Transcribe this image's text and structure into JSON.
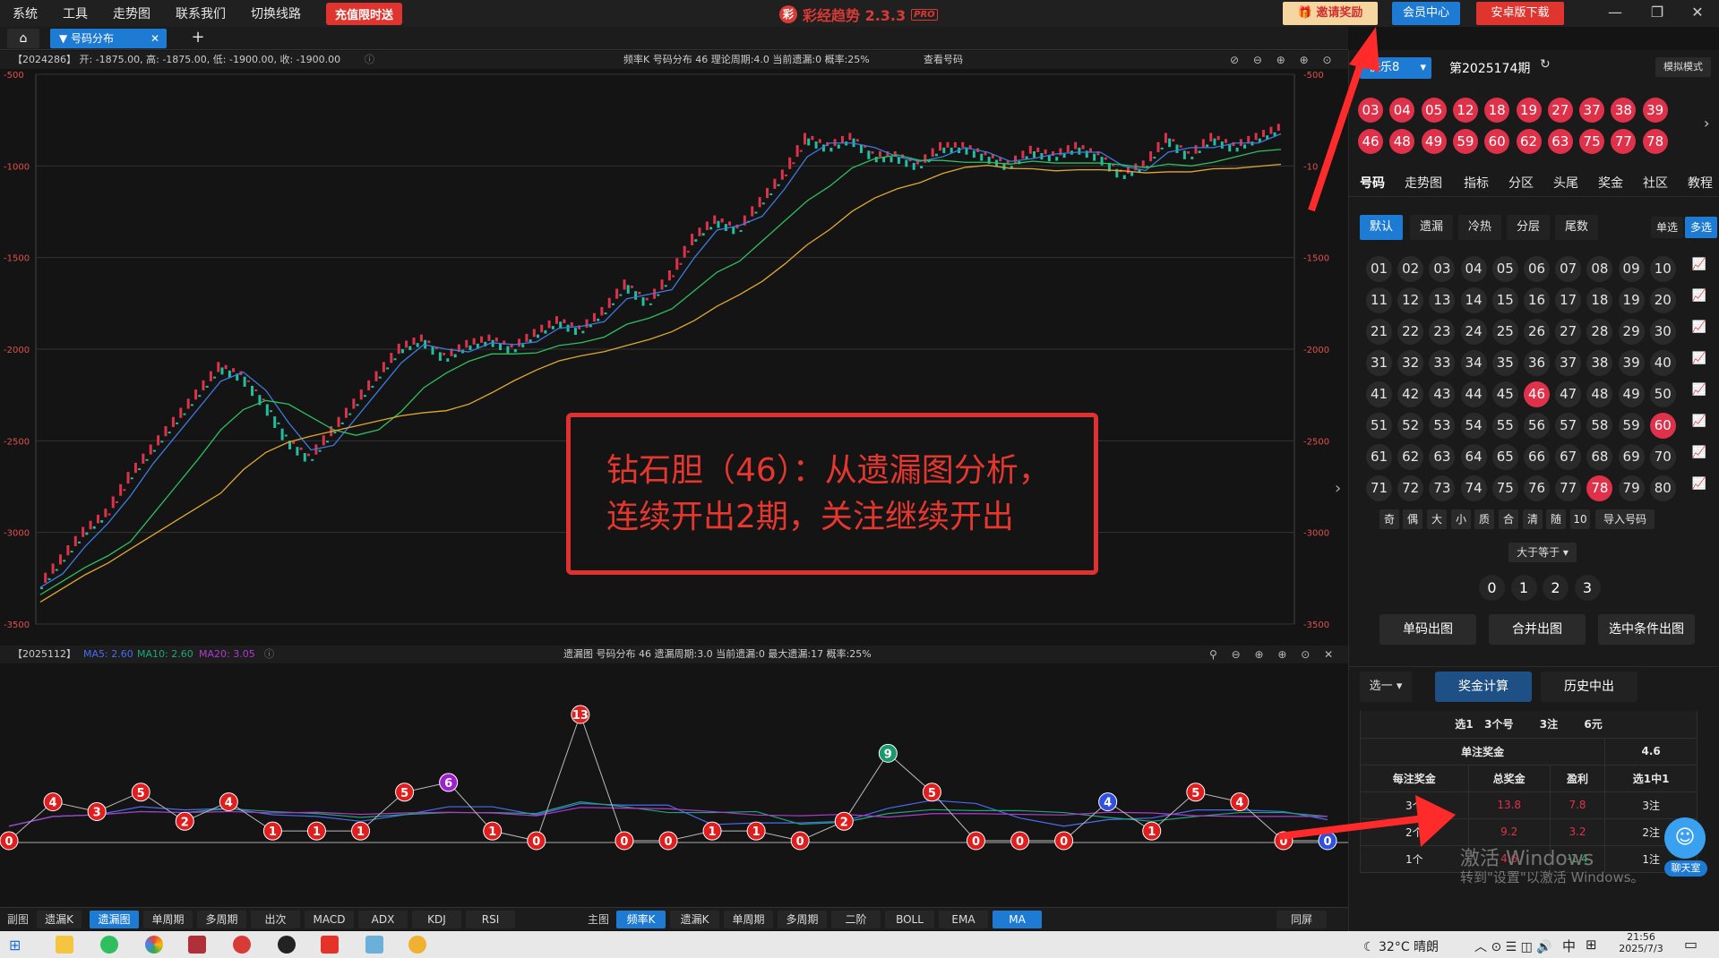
{
  "menu": [
    "系统",
    "工具",
    "走势图",
    "联系我们",
    "切换线路"
  ],
  "recharge_label": "充值限时送",
  "app_title": "彩经趋势 2.3.3",
  "app_badge": "PRO",
  "top_buttons": {
    "invite": "邀请奖励",
    "member": "会员中心",
    "android": "安卓版下载"
  },
  "window_controls": {
    "min": "—",
    "max": "❐",
    "close": "✕"
  },
  "tabs": {
    "home_icon": "home-icon",
    "active": "号码分布",
    "add": "+"
  },
  "main_chart": {
    "info_left": "【2024286】  开: -1875.00, 高: -1875.00, 低: -1900.00, 收: -1900.00",
    "info_center": "频率K  号码分布  46    理论周期:4.0  当前遗漏:0  概率:25%",
    "view_button": "查看号码",
    "yticks": [
      "-500",
      "-1000",
      "-1500",
      "-2000",
      "-2500",
      "-3000",
      "-3500"
    ],
    "yticks_right": [
      "-500",
      "-10",
      "-1500",
      "-2000",
      "-2500",
      "-3000",
      "-3500"
    ]
  },
  "annotation": {
    "line1": "钻石胆（46）：从遗漏图分析，",
    "line2": "连续开出2期，关注继续开出"
  },
  "sub_chart": {
    "info_left": "【2025112】",
    "ma5": "MA5: 2.60",
    "ma10": "MA10: 2.60",
    "ma20": "MA20: 3.05",
    "info_center": "遗漏图  号码分布  46    遗漏周期:3.0  当前遗漏:0  最大遗漏:17  概率:25%"
  },
  "chart_data": [
    {
      "type": "line",
      "title": "",
      "xlabel": "",
      "ylabel": "",
      "ylim": [
        -3500,
        -500
      ],
      "series": [
        {
          "name": "",
          "values": [
            -3300,
            -3150,
            -3000,
            -2900,
            -2700,
            -2550,
            -2400,
            -2250,
            -2100,
            -2150,
            -2300,
            -2500,
            -2600,
            -2450,
            -2300,
            -2150,
            -2000,
            -1950,
            -2050,
            -1980,
            -1950,
            -2000,
            -1920,
            -1850,
            -1900,
            -1800,
            -1650,
            -1750,
            -1600,
            -1400,
            -1300,
            -1350,
            -1200,
            -1050,
            -850,
            -900,
            -850,
            -950,
            -950,
            -1000,
            -900,
            -900,
            -950,
            -1000,
            -920,
            -950,
            -900,
            -950,
            -1050,
            -1000,
            -850,
            -950,
            -850,
            -900,
            -850,
            -800
          ]
        }
      ]
    },
    {
      "type": "scatter",
      "title": "",
      "ylabel": "",
      "ylim": [
        0,
        13
      ],
      "series": [
        {
          "name": "",
          "values": [
            0,
            4,
            3,
            5,
            2,
            4,
            1,
            1,
            1,
            5,
            6,
            1,
            0,
            13,
            0,
            0,
            1,
            1,
            0,
            2,
            9,
            5,
            0,
            0,
            0,
            4,
            1,
            5,
            4,
            0,
            0
          ]
        }
      ]
    }
  ],
  "bottom_toolbar": {
    "left_label": "副图",
    "left_buttons": [
      "遗漏K",
      "遗漏图",
      "单周期",
      "多周期",
      "出次",
      "MACD",
      "ADX",
      "KDJ",
      "RSI"
    ],
    "left_active": "遗漏图",
    "right_label": "主图",
    "right_buttons": [
      "频率K",
      "遗漏K",
      "单周期",
      "多周期",
      "二阶",
      "BOLL",
      "EMA",
      "MA"
    ],
    "right_active": [
      "频率K",
      "MA"
    ],
    "sync": "同屏"
  },
  "right_panel": {
    "lottery_select": "快乐8",
    "period": "第2025174期",
    "mode": "模拟模式",
    "drawn_numbers": [
      "03",
      "04",
      "05",
      "12",
      "18",
      "19",
      "27",
      "37",
      "38",
      "39",
      "46",
      "48",
      "49",
      "59",
      "60",
      "62",
      "63",
      "75",
      "77",
      "78"
    ],
    "nav_tabs": [
      "号码",
      "走势图",
      "指标",
      "分区",
      "头尾",
      "奖金",
      "社区",
      "教程"
    ],
    "sub_tabs": [
      "默认",
      "遗漏",
      "冷热",
      "分层",
      "尾数"
    ],
    "single_multi": [
      "单选",
      "多选"
    ],
    "grid_numbers": [
      "01",
      "02",
      "03",
      "04",
      "05",
      "06",
      "07",
      "08",
      "09",
      "10",
      "11",
      "12",
      "13",
      "14",
      "15",
      "16",
      "17",
      "18",
      "19",
      "20",
      "21",
      "22",
      "23",
      "24",
      "25",
      "26",
      "27",
      "28",
      "29",
      "30",
      "31",
      "32",
      "33",
      "34",
      "35",
      "36",
      "37",
      "38",
      "39",
      "40",
      "41",
      "42",
      "43",
      "44",
      "45",
      "46",
      "47",
      "48",
      "49",
      "50",
      "51",
      "52",
      "53",
      "54",
      "55",
      "56",
      "57",
      "58",
      "59",
      "60",
      "61",
      "62",
      "63",
      "64",
      "65",
      "66",
      "67",
      "68",
      "69",
      "70",
      "71",
      "72",
      "73",
      "74",
      "75",
      "76",
      "77",
      "78",
      "79",
      "80"
    ],
    "selected_numbers": [
      "46",
      "60",
      "78"
    ],
    "filter_buttons": [
      "奇",
      "偶",
      "大",
      "小",
      "质",
      "合",
      "清",
      "随",
      "10",
      "导入号码"
    ],
    "compare_select": "大于等于",
    "count_balls": [
      "0",
      "1",
      "2",
      "3"
    ],
    "action_buttons": [
      "单码出图",
      "合并出图",
      "选中条件出图"
    ],
    "choose_select": "选一",
    "calc_button": "奖金计算",
    "history_button": "历史中出",
    "prize_summary": [
      "选1",
      "3个号",
      "3注",
      "6元"
    ],
    "prize_single_label": "单注奖金",
    "prize_single_value": "4.6",
    "prize_headers": [
      "每注奖金",
      "总奖金",
      "盈利",
      "选1中1"
    ],
    "prize_rows": [
      [
        "3个",
        "13.8",
        "7.8",
        "3注"
      ],
      [
        "2个",
        "9.2",
        "3.2",
        "2注"
      ],
      [
        "1个",
        "4.6",
        "-1.4",
        "1注"
      ]
    ],
    "watermark_line1": "激活 Windows",
    "watermark_line2": "转到\"设置\"以激活 Windows。",
    "chat_label": "聊天室"
  },
  "taskbar": {
    "weather": "32°C 晴朗",
    "ime": "中",
    "time": "21:56",
    "date": "2025/7/3"
  }
}
